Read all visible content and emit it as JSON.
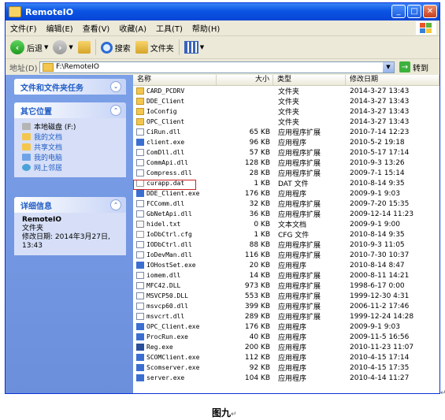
{
  "window": {
    "title": "RemoteIO"
  },
  "menu": [
    "文件(F)",
    "编辑(E)",
    "查看(V)",
    "收藏(A)",
    "工具(T)",
    "帮助(H)"
  ],
  "toolbar": {
    "back": "后退",
    "search": "搜索",
    "folders": "文件夹"
  },
  "address": {
    "label": "地址(D)",
    "path": "F:\\RemoteIO",
    "go": "转到"
  },
  "tasks": {
    "file_tasks_title": "文件和文件夹任务",
    "other_places_title": "其它位置",
    "other_places": [
      "本地磁盘 (F:)",
      "我的文档",
      "共享文档",
      "我的电脑",
      "网上邻居"
    ],
    "details_title": "详细信息",
    "details_name": "RemoteIO",
    "details_type": "文件夹",
    "details_modified": "修改日期: 2014年3月27日, 13:43"
  },
  "columns": {
    "name": "名称",
    "size": "大小",
    "type": "类型",
    "date": "修改日期"
  },
  "files": [
    {
      "name": "CARD_PCDRV",
      "size": "",
      "type": "文件夹",
      "date": "2014-3-27 13:43",
      "icon": "folder"
    },
    {
      "name": "DDE_Client",
      "size": "",
      "type": "文件夹",
      "date": "2014-3-27 13:43",
      "icon": "folder"
    },
    {
      "name": "IoConfig",
      "size": "",
      "type": "文件夹",
      "date": "2014-3-27 13:43",
      "icon": "folder"
    },
    {
      "name": "OPC_Client",
      "size": "",
      "type": "文件夹",
      "date": "2014-3-27 13:43",
      "icon": "folder"
    },
    {
      "name": "CiRun.dll",
      "size": "65 KB",
      "type": "应用程序扩展",
      "date": "2010-7-14 12:23",
      "icon": "dll"
    },
    {
      "name": "client.exe",
      "size": "96 KB",
      "type": "应用程序",
      "date": "2010-5-2 19:18",
      "icon": "exe"
    },
    {
      "name": "ComDll.dll",
      "size": "57 KB",
      "type": "应用程序扩展",
      "date": "2010-5-17 17:14",
      "icon": "dll"
    },
    {
      "name": "CommApi.dll",
      "size": "128 KB",
      "type": "应用程序扩展",
      "date": "2010-9-3 13:26",
      "icon": "dll"
    },
    {
      "name": "Compress.dll",
      "size": "28 KB",
      "type": "应用程序扩展",
      "date": "2009-7-1 15:14",
      "icon": "dll"
    },
    {
      "name": "curapp.dat",
      "size": "1 KB",
      "type": "DAT 文件",
      "date": "2010-8-14 9:35",
      "icon": "file"
    },
    {
      "name": "DDE_Client.exe",
      "size": "176 KB",
      "type": "应用程序",
      "date": "2009-9-1 9:03",
      "icon": "exe"
    },
    {
      "name": "FCComm.dll",
      "size": "32 KB",
      "type": "应用程序扩展",
      "date": "2009-7-20 15:35",
      "icon": "dll"
    },
    {
      "name": "GbNetApi.dll",
      "size": "36 KB",
      "type": "应用程序扩展",
      "date": "2009-12-14 11:23",
      "icon": "dll"
    },
    {
      "name": "hidel.txt",
      "size": "0 KB",
      "type": "文本文档",
      "date": "2009-9-1 9:00",
      "icon": "txt"
    },
    {
      "name": "IoDbCtrl.cfg",
      "size": "1 KB",
      "type": "CFG 文件",
      "date": "2010-8-14 9:35",
      "icon": "file"
    },
    {
      "name": "IODbCtrl.dll",
      "size": "88 KB",
      "type": "应用程序扩展",
      "date": "2010-9-3 11:05",
      "icon": "dll"
    },
    {
      "name": "IoDevMan.dll",
      "size": "116 KB",
      "type": "应用程序扩展",
      "date": "2010-7-30 10:37",
      "icon": "dll"
    },
    {
      "name": "IOHostSet.exe",
      "size": "20 KB",
      "type": "应用程序",
      "date": "2010-8-14 8:47",
      "icon": "exe"
    },
    {
      "name": "iomem.dll",
      "size": "14 KB",
      "type": "应用程序扩展",
      "date": "2000-8-11 14:21",
      "icon": "dll"
    },
    {
      "name": "MFC42.DLL",
      "size": "973 KB",
      "type": "应用程序扩展",
      "date": "1998-6-17 0:00",
      "icon": "dll"
    },
    {
      "name": "MSVCP50.DLL",
      "size": "553 KB",
      "type": "应用程序扩展",
      "date": "1999-12-30 4:31",
      "icon": "dll"
    },
    {
      "name": "msvcp60.dll",
      "size": "399 KB",
      "type": "应用程序扩展",
      "date": "2006-11-2 17:46",
      "icon": "dll"
    },
    {
      "name": "msvcrt.dll",
      "size": "289 KB",
      "type": "应用程序扩展",
      "date": "1999-12-24 14:28",
      "icon": "dll"
    },
    {
      "name": "OPC_Client.exe",
      "size": "176 KB",
      "type": "应用程序",
      "date": "2009-9-1 9:03",
      "icon": "exe"
    },
    {
      "name": "ProcRun.exe",
      "size": "40 KB",
      "type": "应用程序",
      "date": "2009-11-5 16:56",
      "icon": "exe"
    },
    {
      "name": "Reg.exe",
      "size": "200 KB",
      "type": "应用程序",
      "date": "2010-11-23 11:07",
      "icon": "reg"
    },
    {
      "name": "SCOMClient.exe",
      "size": "112 KB",
      "type": "应用程序",
      "date": "2010-4-15 17:14",
      "icon": "exe"
    },
    {
      "name": "Scomserver.exe",
      "size": "92 KB",
      "type": "应用程序",
      "date": "2010-4-15 17:35",
      "icon": "exe"
    },
    {
      "name": "server.exe",
      "size": "104 KB",
      "type": "应用程序",
      "date": "2010-4-14 11:27",
      "icon": "exe"
    }
  ],
  "highlighted_file": "IOHostSet.exe",
  "caption": "图九"
}
